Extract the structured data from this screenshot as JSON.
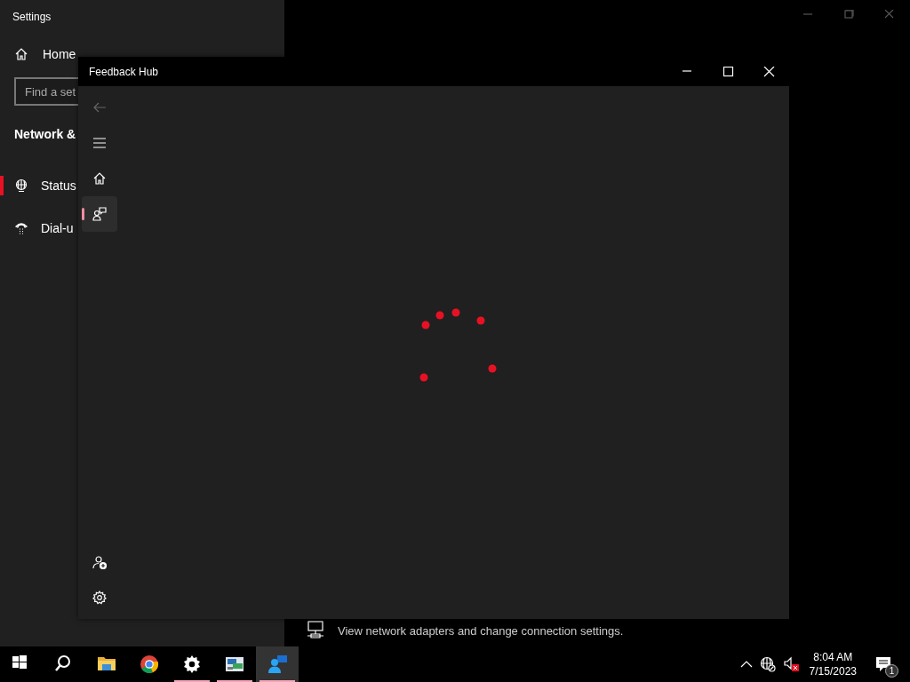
{
  "settings_window": {
    "title": "Settings",
    "home": {
      "label": "Home"
    },
    "search": {
      "placeholder": "Find a set"
    },
    "section_title": "Network &",
    "items": [
      {
        "label": "Status",
        "kind": "globe",
        "selected": true
      },
      {
        "label": "Dial-u",
        "kind": "dialup",
        "selected": false
      }
    ],
    "content": {
      "description": "View network adapters and change connection settings."
    }
  },
  "feedback_hub": {
    "title": "Feedback Hub",
    "back": {
      "disabled": true
    },
    "nav_items": [
      {
        "kind": "menu",
        "selected": false
      },
      {
        "kind": "home",
        "selected": false
      },
      {
        "kind": "feedback",
        "selected": true
      }
    ],
    "bottom_items": [
      {
        "kind": "add-person"
      },
      {
        "kind": "settings"
      }
    ],
    "loading": true
  },
  "taskbar": {
    "apps": [
      {
        "kind": "start",
        "running": false,
        "active": false
      },
      {
        "kind": "search",
        "running": false,
        "active": false
      },
      {
        "kind": "folder",
        "running": false,
        "active": false
      },
      {
        "kind": "chrome",
        "running": false,
        "active": false
      },
      {
        "kind": "gear",
        "running": true,
        "active": false
      },
      {
        "kind": "network-app",
        "running": true,
        "active": false
      },
      {
        "kind": "feedback",
        "running": true,
        "active": true
      }
    ],
    "tray": {
      "time": "8:04 AM",
      "date": "7/15/2023",
      "notification_count": "1"
    }
  }
}
